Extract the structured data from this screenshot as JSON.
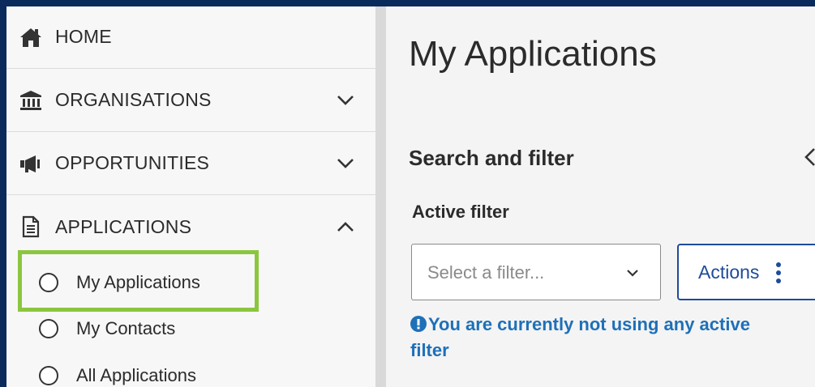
{
  "sidebar": {
    "items": [
      {
        "label": "HOME",
        "icon": "home-icon"
      },
      {
        "label": "ORGANISATIONS",
        "icon": "bank-icon",
        "expanded": false
      },
      {
        "label": "OPPORTUNITIES",
        "icon": "megaphone-icon",
        "expanded": false
      },
      {
        "label": "APPLICATIONS",
        "icon": "document-icon",
        "expanded": true
      }
    ],
    "sub_items": [
      {
        "label": "My Applications",
        "selected": true
      },
      {
        "label": "My Contacts",
        "selected": false
      },
      {
        "label": "All Applications",
        "selected": false
      }
    ]
  },
  "main": {
    "title": "My Applications",
    "search_filter": {
      "title": "Search and filter",
      "active_filter_label": "Active filter",
      "select_placeholder": "Select a filter...",
      "actions_label": "Actions",
      "info_message": "You are currently not using any active filter"
    }
  },
  "colors": {
    "frame_border": "#0b2a5c",
    "highlight": "#8cc63f",
    "accent_blue": "#1e4b9a",
    "info_blue": "#1e70b8"
  }
}
